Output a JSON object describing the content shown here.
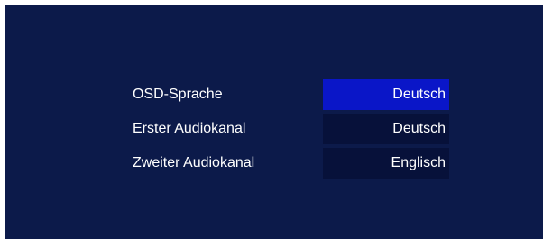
{
  "settings": [
    {
      "label": "OSD-Sprache",
      "value": "Deutsch",
      "selected": true
    },
    {
      "label": "Erster Audiokanal",
      "value": "Deutsch",
      "selected": false
    },
    {
      "label": "Zweiter Audiokanal",
      "value": "Englisch",
      "selected": false
    }
  ],
  "colors": {
    "background": "#0c1a4a",
    "value_box": "#07113a",
    "selected_value_box": "#0a16c8",
    "text": "#ffffff",
    "page_margin": "#ffffff"
  }
}
